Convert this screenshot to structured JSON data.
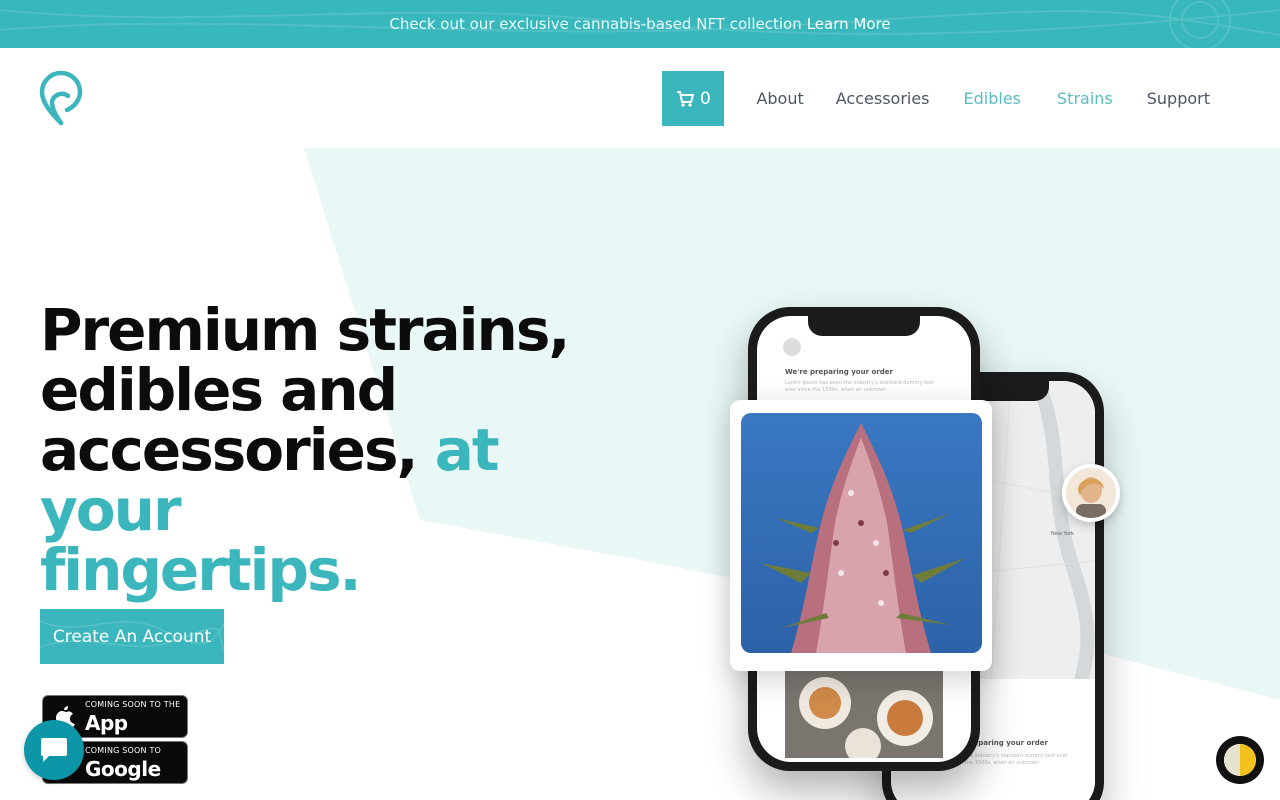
{
  "announcement": {
    "message": "Check out our exclusive cannabis-based NFT collection",
    "link_label": "Learn More"
  },
  "header": {
    "cart_count": "0",
    "nav": [
      {
        "label": "About"
      },
      {
        "label": "Accessories"
      },
      {
        "label": "Edibles"
      },
      {
        "label": "Strains"
      },
      {
        "label": "Support"
      }
    ]
  },
  "hero": {
    "line1": "Premium strains,",
    "line2": "edibles and",
    "line3_dark": "accessories,",
    "line3_accent": "at your",
    "line4_accent": "fingertips.",
    "cta_label": "Create An Account"
  },
  "stores": {
    "apple_small": "COMING SOON TO THE",
    "apple_big": "App Store",
    "google_small": "COMING SOON TO",
    "google_big": "Google Play"
  },
  "phone_front": {
    "title": "We're preparing your order",
    "body": "Lorem Ipsum has been the industry's standard dummy text ever since the 1500s, when an unknown"
  },
  "phone_back": {
    "title": "preparing your order",
    "body": "the industry's standard dummy text ever the 1500s, when an unknown",
    "map_label": "New York"
  },
  "colors": {
    "brand": "#3ab6bc",
    "nav_text": "#4c5566",
    "headline": "#0c0c0c"
  },
  "icons": {
    "logo": "map-pin-logo-icon",
    "cart": "cart-icon",
    "chat": "chat-bubble-icon",
    "theme": "half-moon-toggle-icon",
    "apple": "apple-icon",
    "google": "google-play-icon"
  }
}
